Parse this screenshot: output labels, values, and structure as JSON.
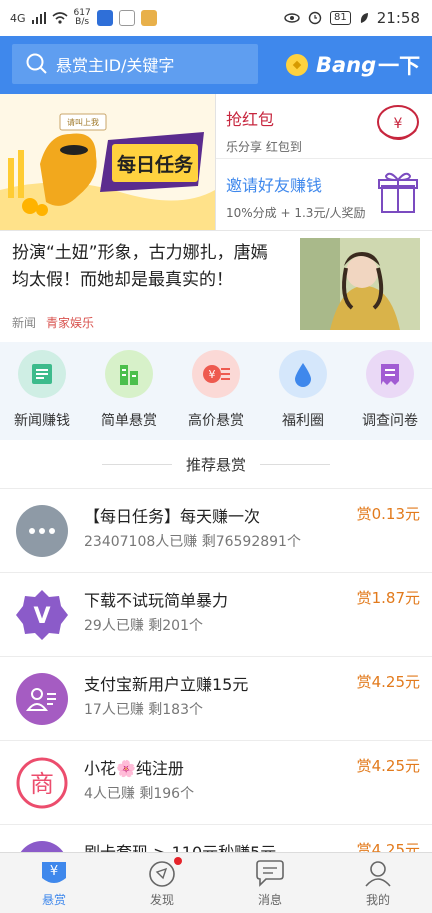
{
  "status_bar": {
    "signal": "4G",
    "speed_top": "617",
    "speed_bottom": "B/s",
    "battery": "81",
    "time": "21:58"
  },
  "header": {
    "search_placeholder": "悬赏主ID/关键字",
    "bang_label": "Bang",
    "bang_suffix": "一下"
  },
  "promo": {
    "banner_title": "每日任务",
    "banner_sign": "请叫上我",
    "items": [
      {
        "title": "抢红包",
        "subtitle": "乐分享 红包到",
        "color": "#c7263e"
      },
      {
        "title": "邀请好友赚钱",
        "subtitle": "10%分成 + 1.3元/人奖励",
        "color": "#3f88ec"
      }
    ]
  },
  "news": {
    "title": "扮演“土妞”形象，古力娜扎，唐嫣均太假！而她却是最真实的！",
    "category": "新闻",
    "source": "青家娱乐"
  },
  "categories": [
    {
      "label": "新闻赚钱",
      "icon": "news-icon"
    },
    {
      "label": "简单悬赏",
      "icon": "building-icon"
    },
    {
      "label": "高价悬赏",
      "icon": "yen-stack-icon"
    },
    {
      "label": "福利圈",
      "icon": "water-drop-icon"
    },
    {
      "label": "调查问卷",
      "icon": "survey-icon"
    }
  ],
  "section_title": "推荐悬赏",
  "tasks": [
    {
      "title": "【每日任务】每天赚一次",
      "stats": "23407108人已赚  剩76592891个",
      "reward": "赏0.13元",
      "icon": "more-dots-icon",
      "color": "#8e9aa6"
    },
    {
      "title": "下载不试玩简单暴力",
      "stats": "29人已赚  剩201个",
      "reward": "赏1.87元",
      "icon": "v-badge-icon",
      "color": "#8b5bc9"
    },
    {
      "title": "支付宝新用户立赚15元",
      "stats": "17人已赚  剩183个",
      "reward": "赏4.25元",
      "icon": "user-card-icon",
      "color": "#a55cc2"
    },
    {
      "title": "小花🌸纯注册",
      "stats": "4人已赚  剩196个",
      "reward": "赏4.25元",
      "icon": "shop-icon",
      "color": "#ec4d6d"
    },
    {
      "title": "刷卡套现 > 110元秒赚5元",
      "stats": "",
      "reward": "赏4.25元",
      "icon": "card-icon",
      "color": "#8b5bc9"
    }
  ],
  "tabs": [
    {
      "label": "悬赏",
      "icon": "reward-icon",
      "active": true
    },
    {
      "label": "发现",
      "icon": "discover-icon",
      "active": false
    },
    {
      "label": "消息",
      "icon": "message-icon",
      "active": false
    },
    {
      "label": "我的",
      "icon": "profile-icon",
      "active": false
    }
  ]
}
